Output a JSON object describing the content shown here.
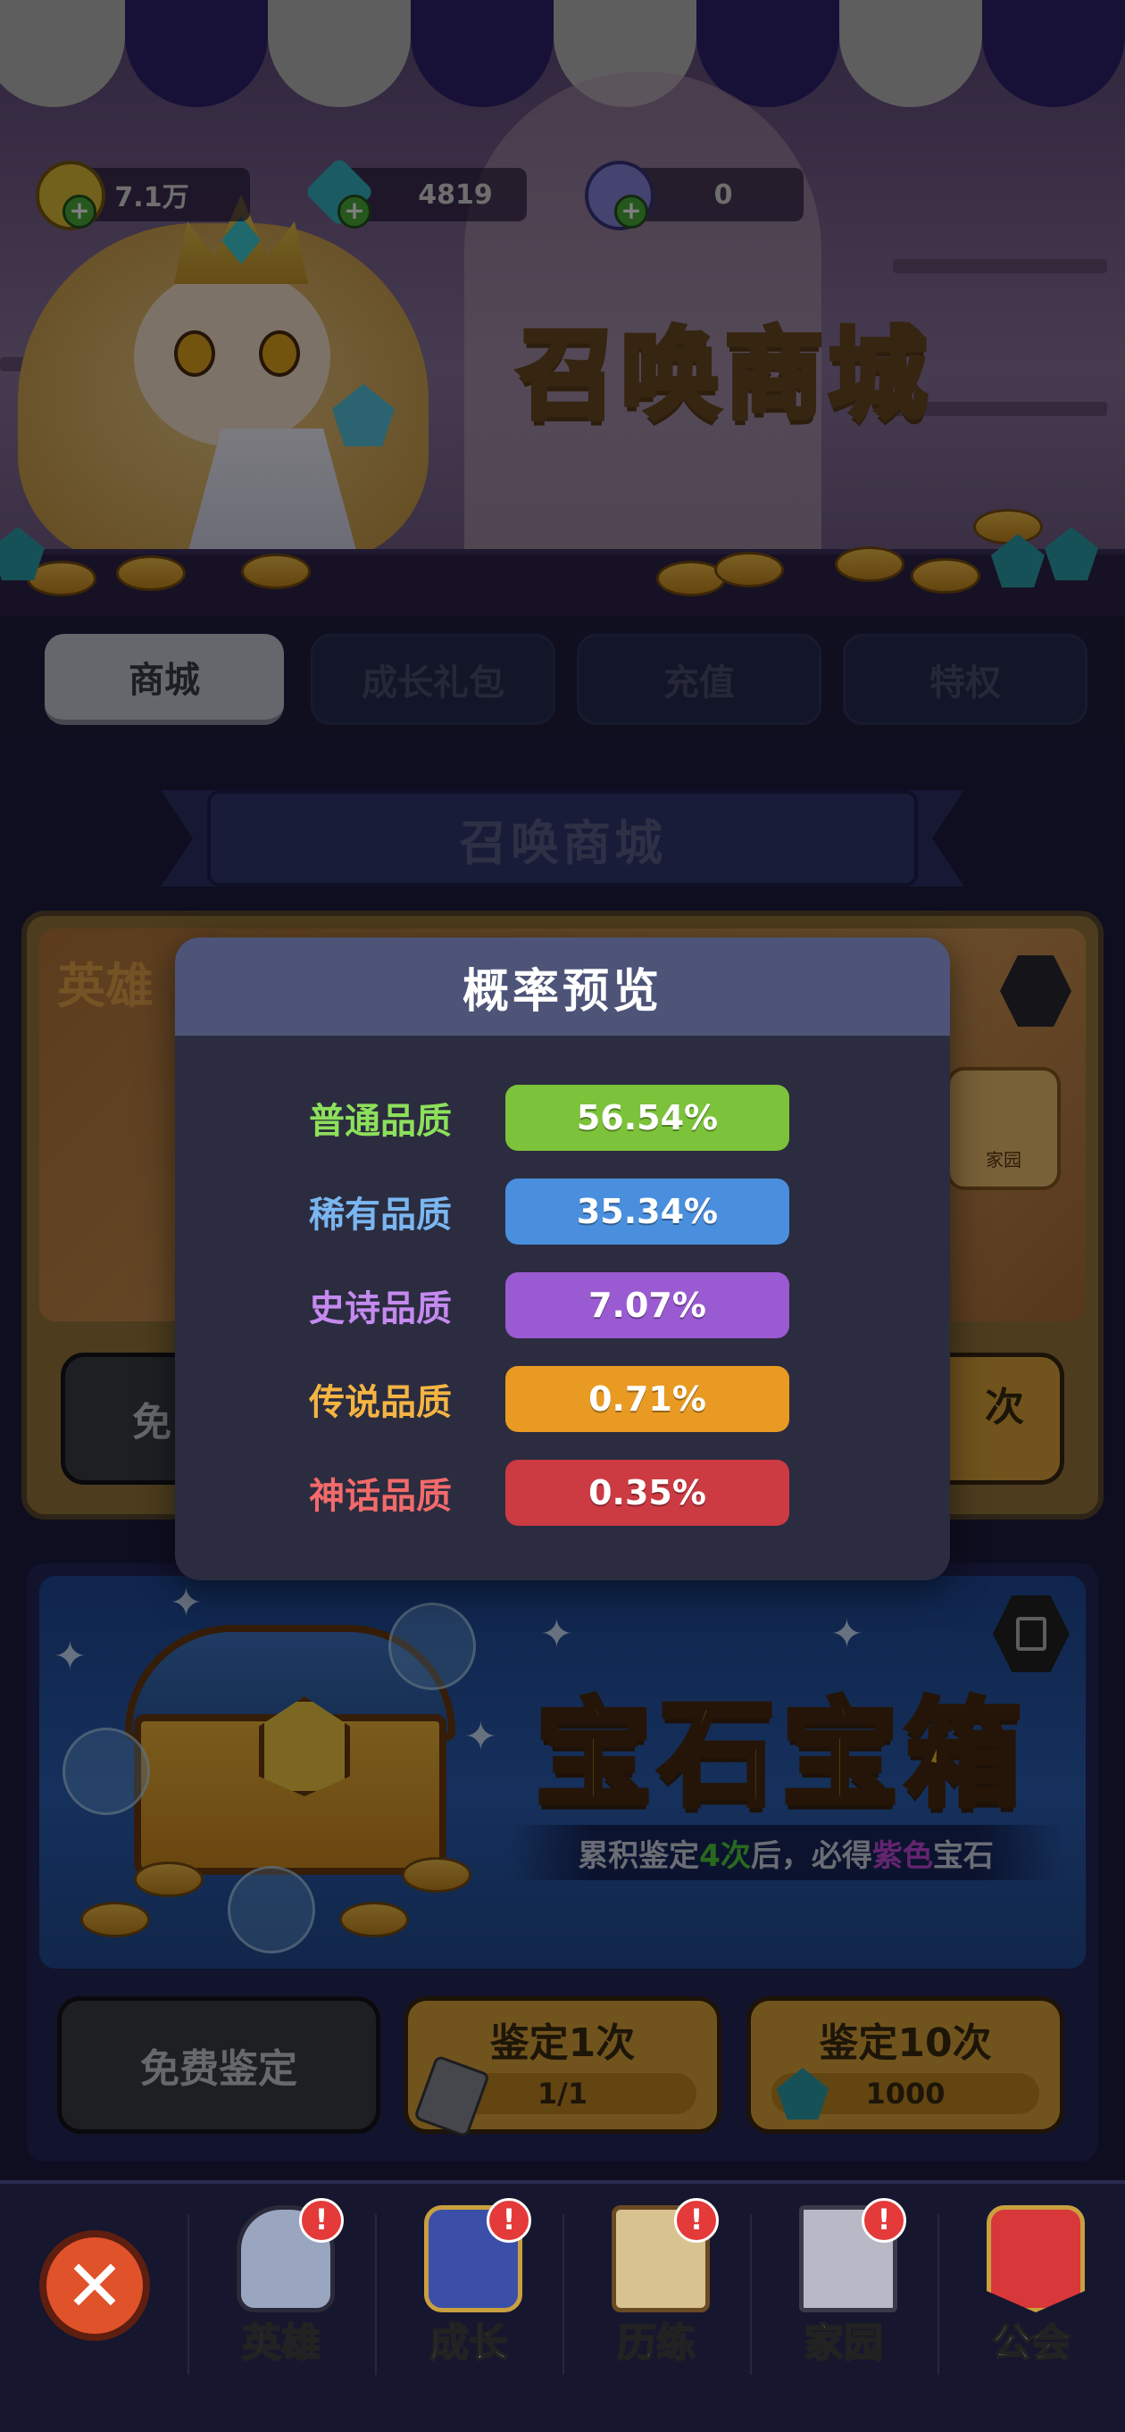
{
  "currencies": [
    {
      "name": "gold-coin",
      "value": "7.1万",
      "color": "#e2c23a"
    },
    {
      "name": "diamond",
      "value": "4819",
      "color": "#36b6c8"
    },
    {
      "name": "purple-token",
      "value": "0",
      "color": "#8a86e0"
    }
  ],
  "banner": {
    "title": "召唤商城"
  },
  "tabs": [
    {
      "label": "商城",
      "active": true
    },
    {
      "label": "成长礼包",
      "active": false
    },
    {
      "label": "充值",
      "active": false
    },
    {
      "label": "特权",
      "active": false
    }
  ],
  "section_title": "召唤商城",
  "hero_card": {
    "title": "英雄",
    "free_button": "免",
    "multi_button": "次",
    "hero_portrait_caption": "家园"
  },
  "gem_card": {
    "title": "宝石宝箱",
    "desc_prefix": "累积鉴定",
    "desc_count": "4次",
    "desc_middle": "后，必得",
    "desc_quality": "紫色",
    "desc_suffix": "宝石",
    "free_button": "免费鉴定",
    "single_button": "鉴定1次",
    "single_cost": "1/1",
    "ten_button": "鉴定10次",
    "ten_cost": "1000"
  },
  "bottom_nav": {
    "items": [
      {
        "label": "英雄",
        "icon": "knight-helmet-icon",
        "badge": "!"
      },
      {
        "label": "成长",
        "icon": "growth-book-icon",
        "badge": "!"
      },
      {
        "label": "历练",
        "icon": "scroll-map-icon",
        "badge": "!"
      },
      {
        "label": "家园",
        "icon": "castle-tower-icon",
        "badge": "!"
      },
      {
        "label": "公会",
        "icon": "guild-banner-icon",
        "badge": ""
      }
    ]
  },
  "modal": {
    "title": "概率预览",
    "rates": [
      {
        "label": "普通品质",
        "value": "56.54%",
        "label_color": "#8de05a",
        "bar_color": "#7cc23a"
      },
      {
        "label": "稀有品质",
        "value": "35.34%",
        "label_color": "#7ab6f0",
        "bar_color": "#4a8fde"
      },
      {
        "label": "史诗品质",
        "value": "7.07%",
        "label_color": "#c48af0",
        "bar_color": "#9a5ad2"
      },
      {
        "label": "传说品质",
        "value": "0.71%",
        "label_color": "#f4b442",
        "bar_color": "#e89a22"
      },
      {
        "label": "神话品质",
        "value": "0.35%",
        "label_color": "#f26a6a",
        "bar_color": "#cc3a42"
      }
    ]
  }
}
